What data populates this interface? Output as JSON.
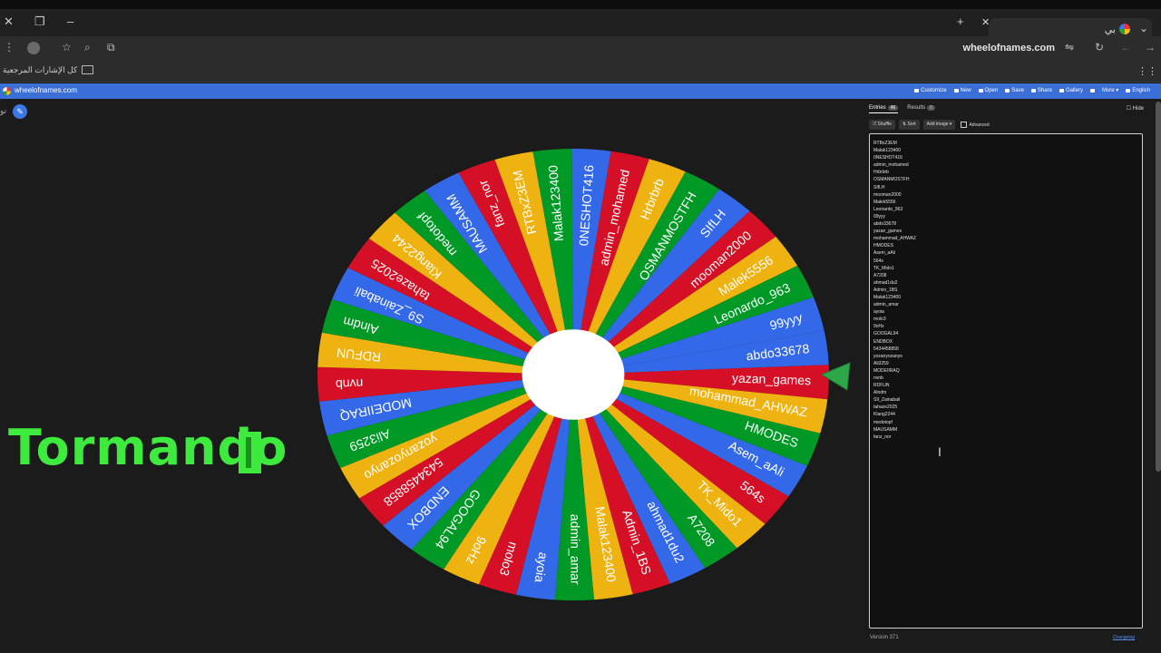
{
  "browser": {
    "tab_title": "بي",
    "url": "wheelofnames.com",
    "bookmarks_label": "كل الإشارات المرجعية"
  },
  "app": {
    "brand": "wheelofnames.com",
    "menu": [
      "Customize",
      "New",
      "Open",
      "Save",
      "Share",
      "Gallery",
      "",
      "More ▾",
      "English"
    ],
    "left_edge": "تو"
  },
  "overlay_text": "Tormando",
  "panel": {
    "tab_entries": "Entries",
    "entries_count": "46",
    "tab_results": "Results",
    "results_count": "0",
    "hide_label": "Hide",
    "shuffle": "Shuffle",
    "sort": "Sort",
    "add_image": "Add image ▾",
    "advanced": "Advanced",
    "version": "Version 371",
    "changelog": "Changelog"
  },
  "entries": [
    "RTBxZ3EM",
    "Malak123400",
    "0NESHOT416",
    "admin_mohamed",
    "Hrbrbrb",
    "OSMANMOSTFH",
    "SIfLH",
    "mooman2000",
    "Malek5556",
    "Leonardo_963",
    "99yyy",
    "abdo33678",
    "yazan_games",
    "mohammad_AHWAZ",
    "HMODES",
    "Asem_aAli",
    "564s",
    "TK_Mido1",
    "A7208",
    "ahmad1du2",
    "Admin_1BS",
    "Malak123400",
    "admin_amar",
    "ayoia",
    "molo3",
    "9oHz",
    "GOOGAL94",
    "ENDBOX",
    "5434458858",
    "yozanyozanyo",
    "Ali3259",
    "MODEIIRAQ",
    "nvnb",
    "RDFUN",
    "Alndm",
    "S9_Zainabali",
    "tahaze2025",
    "Klang2244",
    "medotopf",
    "MAUSAMM",
    "fanz_nor"
  ],
  "wheel": {
    "colors": [
      "#3369e8",
      "#d50f25",
      "#eeb211",
      "#009925"
    ],
    "slices": [
      "abdo33678",
      "yazan_games",
      "mohammad_AHWAZ",
      "HMODES",
      "Asem_aAli",
      "564s",
      "TK_Mido1",
      "A7208",
      "ahmad1du2",
      "Admin_1BS",
      "Malak123400",
      "admin_amar",
      "ayoia",
      "molo3",
      "9oHz",
      "GOOGAL94",
      "ENDBOX",
      "5434458858",
      "yozanyozanyo",
      "Ali3259",
      "MODEIIRAQ",
      "nvnb",
      "RDFUN",
      "Alndm",
      "S9_Zainabali",
      "tahaze2025",
      "Klang2244",
      "medotopf",
      "MAUSAMM",
      "fanz_nor",
      "RTBxZ3EM",
      "Malak123400",
      "0NESHOT416",
      "admin_mohamed",
      "Hrbrbrb",
      "OSMANMOSTFH",
      "SIfLH",
      "mooman2000",
      "Malek5556",
      "Leonardo_963",
      "99yyy"
    ]
  }
}
